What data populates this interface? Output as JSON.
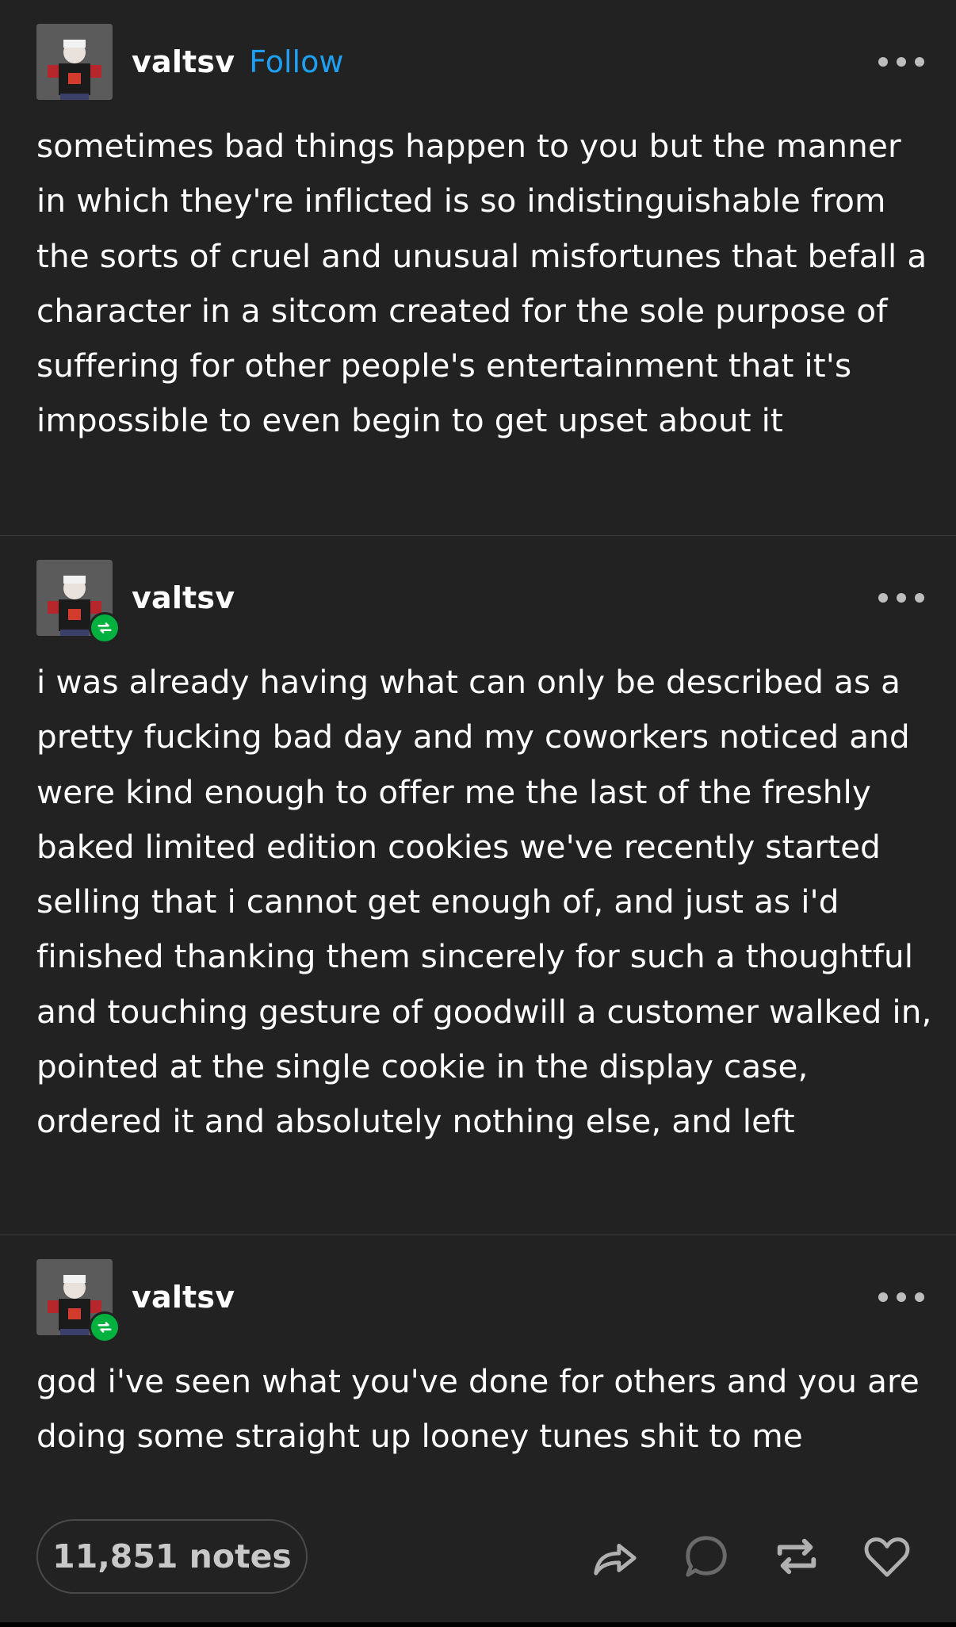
{
  "post": {
    "blocks": [
      {
        "username": "valtsv",
        "follow_label": "Follow",
        "avatar_icon": "avatar-image",
        "text": "sometimes bad things happen to you but the manner in which they're inflicted is so indistinguishable from the sorts of cruel and unusual misfortunes that befall a character in a sitcom created for the sole purpose of suffering for other people's entertainment that it's impossible to even begin to get upset about it"
      },
      {
        "username": "valtsv",
        "badge_icon": "reblog-icon",
        "text": "i was already having what can only be described as a pretty fucking bad day and my coworkers noticed and were kind enough to offer me the last of the freshly baked limited edition cookies we've recently started selling that i cannot get enough of, and just as i'd finished thanking them sincerely for such a thoughtful and touching gesture of goodwill a customer walked in, pointed at the single cookie in the display case, ordered it and absolutely nothing else, and left"
      },
      {
        "username": "valtsv",
        "badge_icon": "reblog-icon",
        "text": "god i've seen what you've done for others and you are doing some straight up looney tunes shit to me"
      }
    ],
    "footer": {
      "notes_label": "11,851 notes",
      "actions": [
        "share-icon",
        "reply-icon",
        "reblog-icon",
        "like-icon"
      ]
    }
  },
  "colors": {
    "background": "#222222",
    "follow": "#1ea0f2",
    "reblog_badge": "#00b140",
    "divider": "#3a3a3a"
  }
}
